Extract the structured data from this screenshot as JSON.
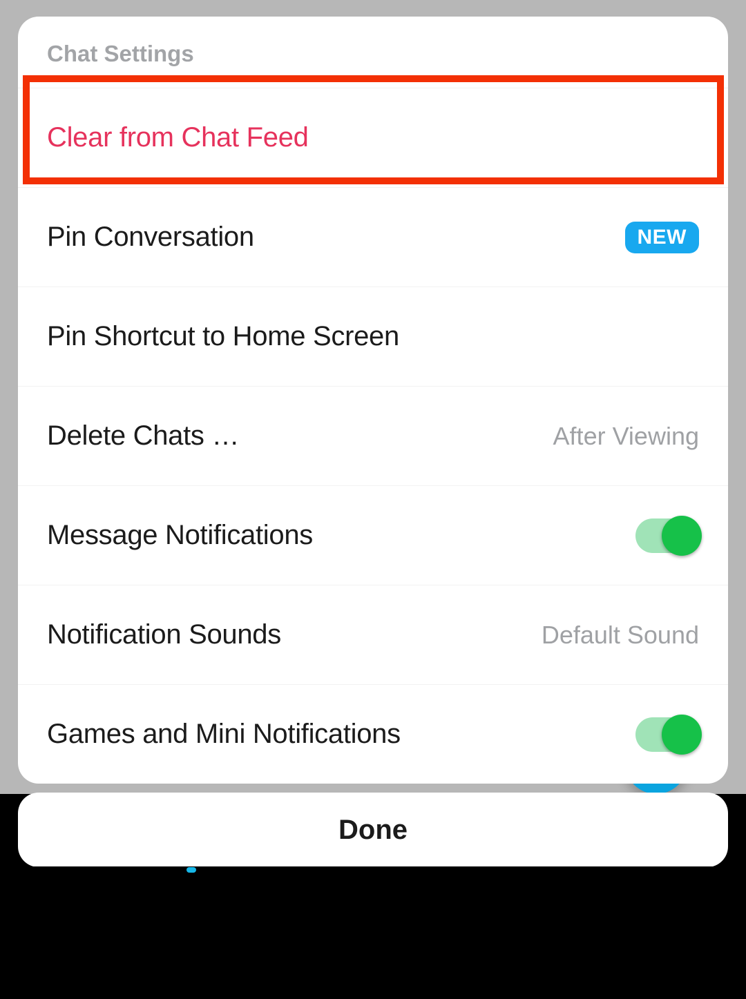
{
  "header": {
    "title": "Chat Settings"
  },
  "rows": {
    "clear_feed": {
      "label": "Clear from Chat Feed"
    },
    "pin_conversation": {
      "label": "Pin Conversation",
      "badge": "NEW"
    },
    "pin_shortcut": {
      "label": "Pin Shortcut to Home Screen"
    },
    "delete_chats": {
      "label": "Delete Chats …",
      "value": "After Viewing"
    },
    "message_notifications": {
      "label": "Message Notifications",
      "toggle": true
    },
    "notification_sounds": {
      "label": "Notification Sounds",
      "value": "Default Sound"
    },
    "games_mini": {
      "label": "Games and Mini Notifications",
      "toggle": true
    }
  },
  "done_button": {
    "label": "Done"
  },
  "colors": {
    "danger": "#e6325c",
    "accent": "#18a8ef",
    "toggle_on": "#16c149",
    "highlight": "#f33005"
  }
}
